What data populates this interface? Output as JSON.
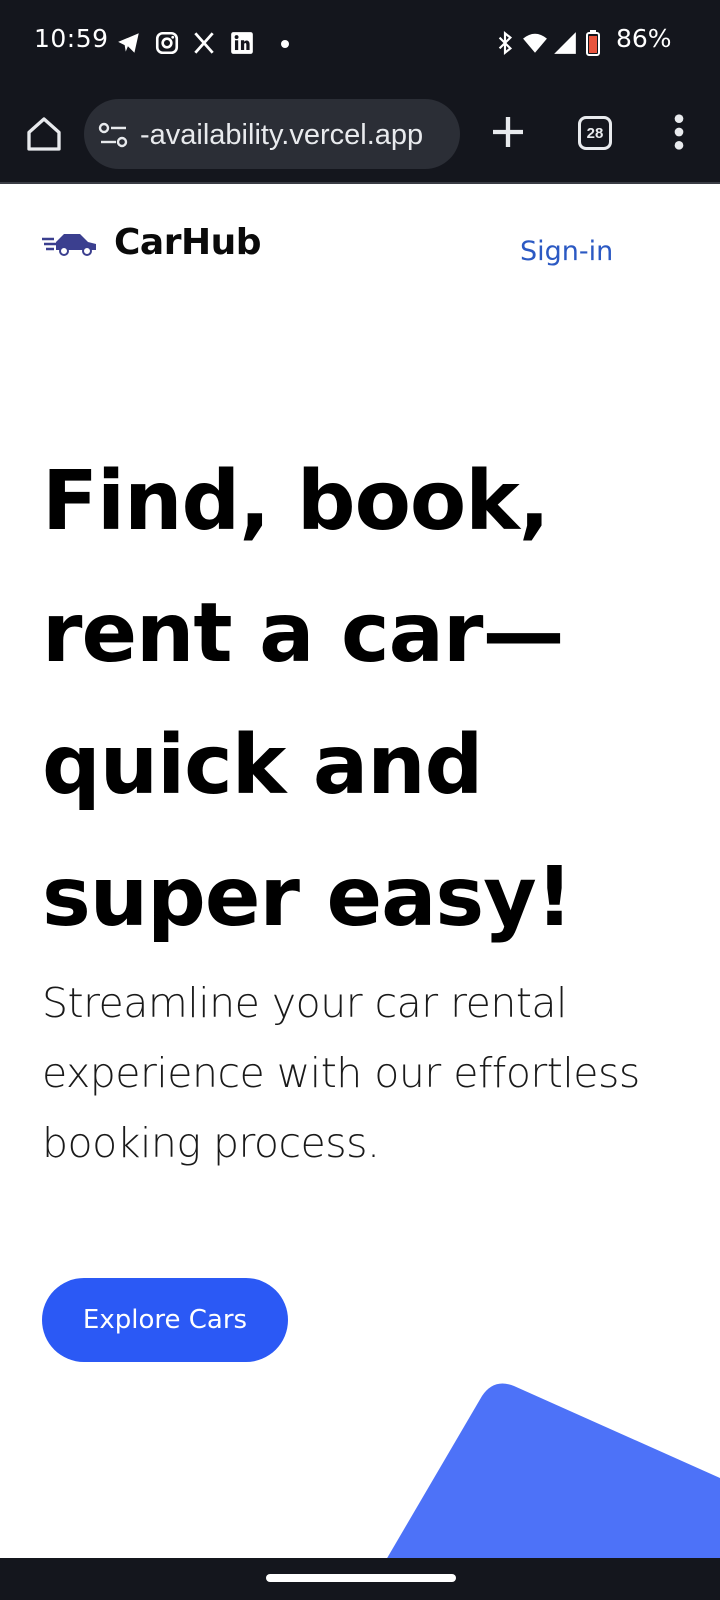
{
  "status_bar": {
    "time": "10:59",
    "battery": "86%",
    "icons": [
      "telegram-icon",
      "instagram-icon",
      "x-icon",
      "linkedin-icon",
      "notification-dot",
      "bluetooth-icon",
      "wifi-icon",
      "cell-signal-icon",
      "battery-icon"
    ]
  },
  "browser": {
    "url": "-availability.vercel.app",
    "tab_count": "28",
    "icons": [
      "home-icon",
      "site-settings-icon",
      "plus-icon",
      "tab-switcher-icon",
      "more-vert-icon"
    ]
  },
  "header": {
    "brand": "CarHub",
    "signin_label": "Sign-in"
  },
  "hero": {
    "title": "Find, book, rent a car—quick and super easy!",
    "subtitle": "Streamline your car rental experience with our effortless booking process.",
    "cta_label": "Explore Cars"
  },
  "colors": {
    "brand_blue": "#2B59F5",
    "link_blue": "#2B59C3",
    "shape_blue": "#4D72F8",
    "logo_navy": "#3B3F8F",
    "system_bar": "#14161D"
  }
}
